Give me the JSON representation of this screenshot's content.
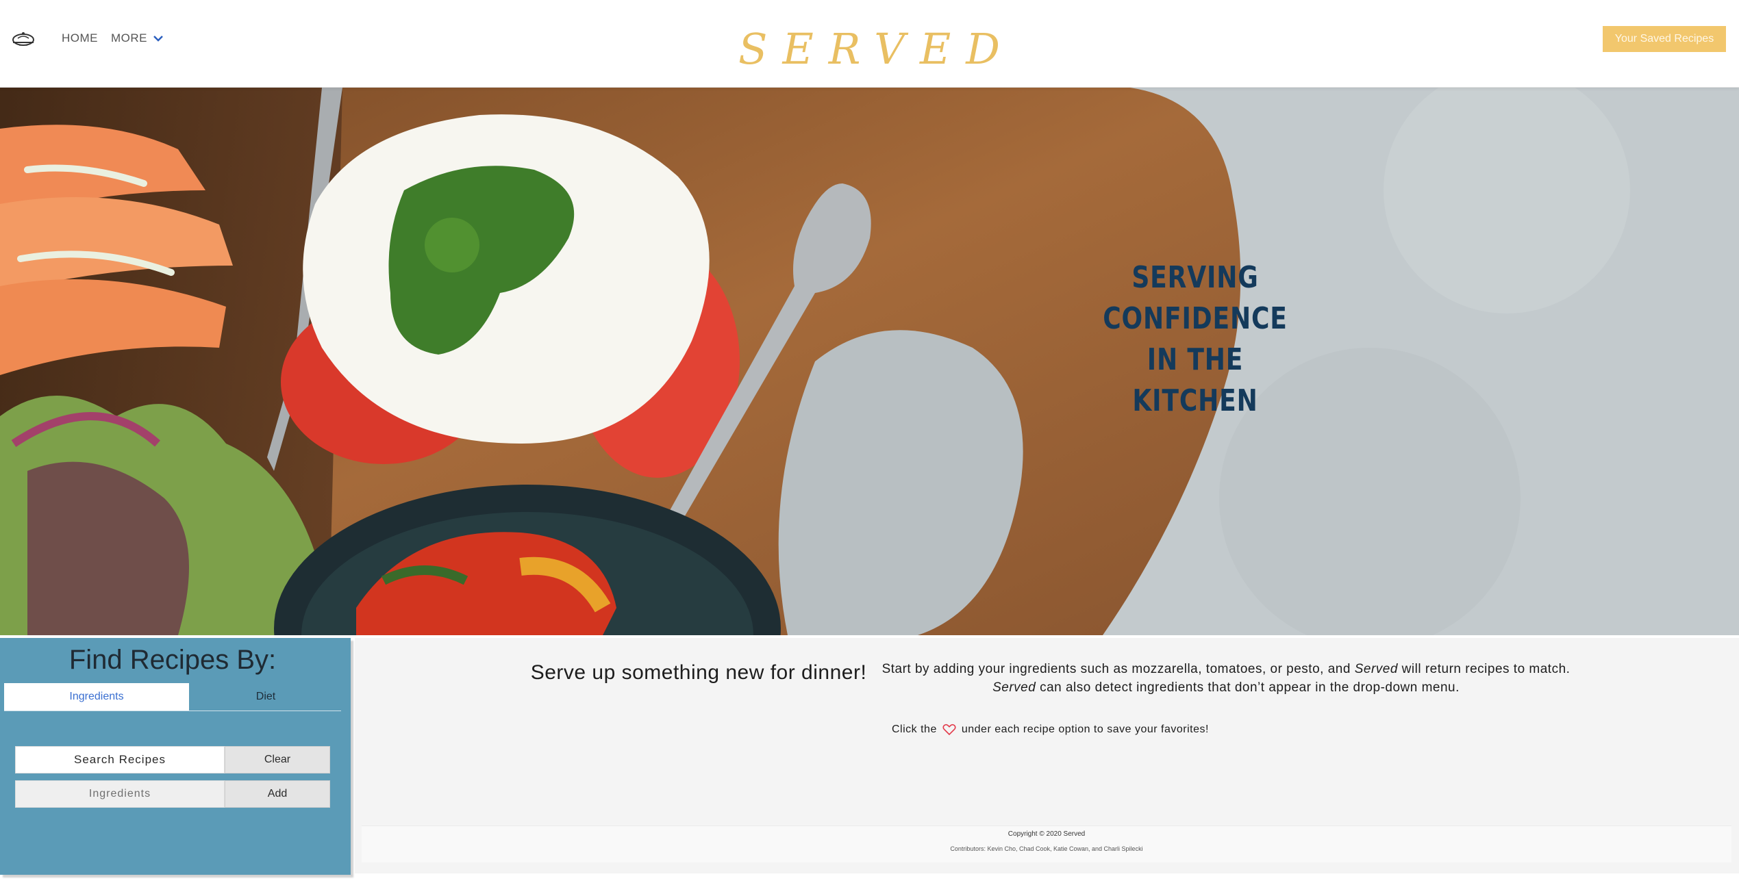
{
  "header": {
    "logo_icon": "cloche-icon",
    "nav": {
      "home": "HOME",
      "more": "MORE"
    },
    "brand": "SERVED",
    "saved_button": "Your Saved Recipes"
  },
  "hero": {
    "headline_lines": [
      "SERVING CONFIDENCE",
      "IN THE",
      "KITCHEN"
    ]
  },
  "search_panel": {
    "title": "Find Recipes By:",
    "tabs": [
      {
        "label": "Ingredients",
        "active": true
      },
      {
        "label": "Diet",
        "active": false
      }
    ],
    "search_button": "Search Recipes",
    "clear_button": "Clear",
    "ingredients_placeholder": "Ingredients",
    "ingredients_value": "",
    "add_button": "Add"
  },
  "main": {
    "headline": "Serve up something new for dinner!",
    "description": {
      "line1_pre": "Start by adding your ingredients such as mozzarella, tomatoes, or pesto, and ",
      "line1_em": "Served",
      "line1_post": " will return recipes to match.",
      "line2_em": "Served",
      "line2_post": " can also detect ingredients that don’t appear in the drop-down menu."
    },
    "favorite_hint": {
      "pre": "Click the",
      "icon": "heart-icon",
      "post": "under each recipe option to save your favorites!"
    }
  },
  "footer": {
    "copyright": "Copyright © 2020 Served",
    "contributors": "Contributors: Kevin Cho, Chad Cook, Katie Cowan, and Charli Spilecki"
  },
  "colors": {
    "brand_gold": "#e9bf62",
    "saved_button": "#f2c76d",
    "panel_blue": "#5b9bb7",
    "headline_navy": "#143a5b",
    "tab_active_text": "#3a6fd1"
  }
}
